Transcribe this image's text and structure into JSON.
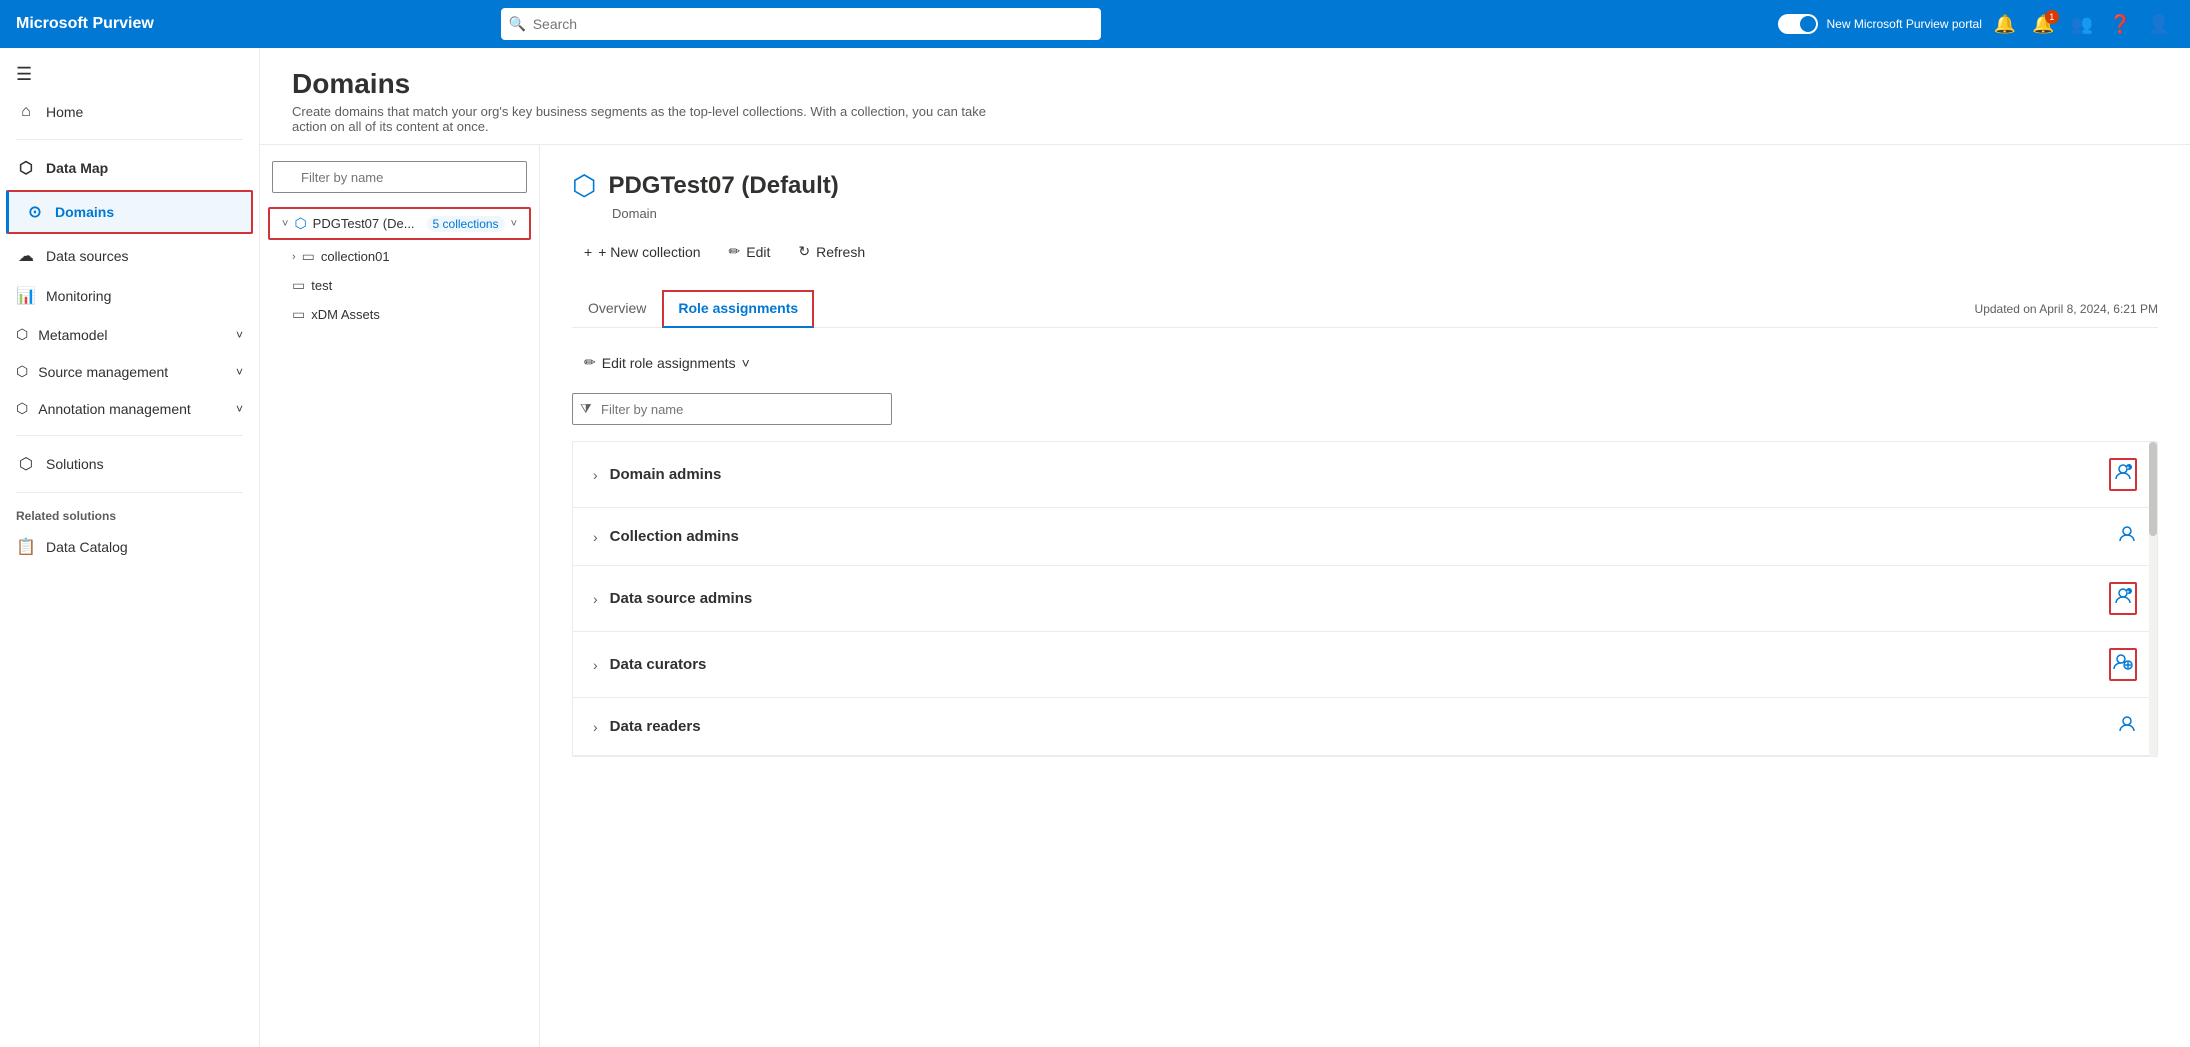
{
  "brand": "Microsoft Purview",
  "topnav": {
    "search_placeholder": "Search",
    "toggle_label": "New Microsoft Purview portal",
    "notification_count": "1"
  },
  "sidebar": {
    "hamburger": "☰",
    "items": [
      {
        "id": "home",
        "label": "Home",
        "icon": "⌂"
      },
      {
        "id": "data-map",
        "label": "Data Map",
        "icon": "⬡",
        "bold": true
      },
      {
        "id": "domains",
        "label": "Domains",
        "icon": "⊙",
        "active": true
      },
      {
        "id": "data-sources",
        "label": "Data sources",
        "icon": "⬡"
      },
      {
        "id": "monitoring",
        "label": "Monitoring",
        "icon": "📊"
      },
      {
        "id": "metamodel",
        "label": "Metamodel",
        "icon": "⬡",
        "expandable": true
      },
      {
        "id": "source-management",
        "label": "Source management",
        "icon": "⬡",
        "expandable": true
      },
      {
        "id": "annotation-management",
        "label": "Annotation management",
        "icon": "⬡",
        "expandable": true
      },
      {
        "id": "solutions",
        "label": "Solutions",
        "icon": "⬡"
      }
    ],
    "related_solutions_title": "Related solutions",
    "related_items": [
      {
        "id": "data-catalog",
        "label": "Data Catalog",
        "icon": "📋"
      }
    ]
  },
  "domains_header": {
    "title": "Domains",
    "description": "Create domains that match your org's key business segments as the top-level collections. With a collection, you can take action on all of its content at once."
  },
  "tree": {
    "filter_placeholder": "Filter by name",
    "root": {
      "label": "PDGTest07 (De...",
      "collections_count": "5 collections",
      "icon": "⬡"
    },
    "children": [
      {
        "label": "collection01",
        "icon": "▭"
      },
      {
        "label": "test",
        "icon": "▭"
      },
      {
        "label": "xDM Assets",
        "icon": "▭"
      }
    ]
  },
  "detail": {
    "domain_icon": "⬡",
    "title": "PDGTest07 (Default)",
    "subtitle": "Domain",
    "toolbar": {
      "new_collection": "+ New collection",
      "edit": "Edit",
      "refresh": "Refresh"
    },
    "tabs": [
      {
        "id": "overview",
        "label": "Overview"
      },
      {
        "id": "role-assignments",
        "label": "Role assignments",
        "active": true
      }
    ],
    "updated_label": "Updated on April 8, 2024, 6:21 PM",
    "role_assignments": {
      "edit_btn": "Edit role assignments",
      "filter_placeholder": "Filter by name",
      "roles": [
        {
          "id": "domain-admins",
          "label": "Domain admins",
          "icon": "👤+",
          "highlighted": true
        },
        {
          "id": "collection-admins",
          "label": "Collection admins",
          "icon": "👤"
        },
        {
          "id": "data-source-admins",
          "label": "Data source admins",
          "icon": "👤+",
          "highlighted": true
        },
        {
          "id": "data-curators",
          "label": "Data curators",
          "icon": "👤",
          "highlighted": true
        },
        {
          "id": "data-readers",
          "label": "Data readers",
          "icon": "👤"
        }
      ]
    }
  }
}
